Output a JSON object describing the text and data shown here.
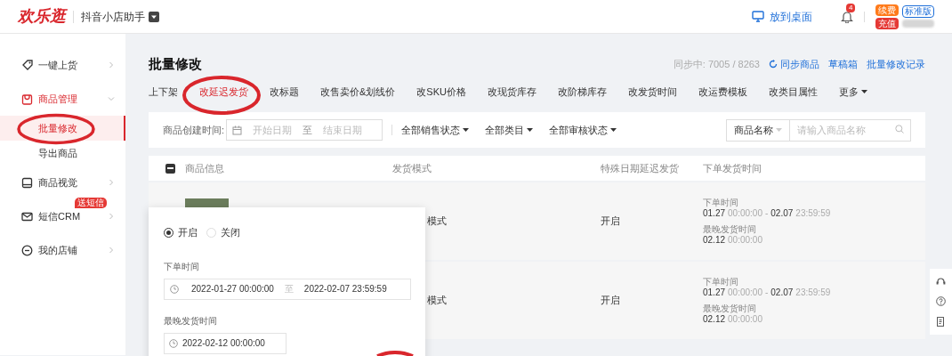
{
  "header": {
    "logo": "欢乐逛",
    "app_name": "抖音小店助手",
    "desktop_link": "放到桌面",
    "notification_count": "4",
    "renew_badge": "续费",
    "recharge_badge": "充值",
    "plan_badge": "标准版"
  },
  "sidebar": {
    "items": [
      {
        "label": "一键上货",
        "active": false,
        "expanded": false
      },
      {
        "label": "商品管理",
        "active": true,
        "expanded": true,
        "children": [
          {
            "label": "批量修改",
            "selected": true
          },
          {
            "label": "导出商品",
            "selected": false
          }
        ]
      },
      {
        "label": "商品视觉",
        "active": false,
        "expanded": false
      },
      {
        "label": "短信CRM",
        "active": false,
        "expanded": false,
        "badge": "送短信"
      },
      {
        "label": "我的店铺",
        "active": false,
        "expanded": false
      }
    ]
  },
  "page": {
    "title": "批量修改",
    "sync_status": "同步中: 7005 / 8263",
    "links": [
      "同步商品",
      "草稿箱",
      "批量修改记录"
    ]
  },
  "tabs": [
    {
      "label": "上下架",
      "selected": false
    },
    {
      "label": "改延迟发货",
      "selected": true
    },
    {
      "label": "改标题",
      "selected": false
    },
    {
      "label": "改售卖价&划线价",
      "selected": false
    },
    {
      "label": "改SKU价格",
      "selected": false
    },
    {
      "label": "改现货库存",
      "selected": false
    },
    {
      "label": "改阶梯库存",
      "selected": false
    },
    {
      "label": "改发货时间",
      "selected": false
    },
    {
      "label": "改运费模板",
      "selected": false
    },
    {
      "label": "改类目属性",
      "selected": false
    }
  ],
  "more_menu": "更多",
  "filters": {
    "created_label": "商品创建时间:",
    "start_placeholder": "开始日期",
    "separator": "至",
    "end_placeholder": "结束日期",
    "dropdowns": [
      "全部销售状态",
      "全部类目",
      "全部审核状态"
    ],
    "search_type": "商品名称",
    "search_placeholder": "请输入商品名称"
  },
  "table": {
    "columns": [
      "商品信息",
      "发货模式",
      "特殊日期延迟发货",
      "下单发货时间"
    ],
    "header_indeterminate": true,
    "rows": [
      {
        "delivery_mode": "模式",
        "special_delay": "开启",
        "order_label": "下单时间",
        "order_start_date": "01.27",
        "order_start_time": "00:00:00",
        "range_separator": "-",
        "order_end_date": "02.07",
        "order_end_time": "23:59:59",
        "latest_label": "最晚发货时间",
        "latest_date": "02.12",
        "latest_time": "00:00:00"
      },
      {
        "delivery_mode": "模式",
        "special_delay": "开启",
        "order_label": "下单时间",
        "order_start_date": "01.27",
        "order_start_time": "00:00:00",
        "range_separator": "-",
        "order_end_date": "02.07",
        "order_end_time": "23:59:59",
        "latest_label": "最晚发货时间",
        "latest_date": "02.12",
        "latest_time": "00:00:00"
      }
    ]
  },
  "popup": {
    "radios": [
      {
        "label": "开启",
        "selected": true
      },
      {
        "label": "关闭",
        "selected": false
      }
    ],
    "order_time_label": "下单时间",
    "order_start": "2022-01-27 00:00:00",
    "separator": "至",
    "order_end": "2022-02-07 23:59:59",
    "latest_label": "最晚发货时间",
    "latest_value": "2022-02-12 00:00:00"
  }
}
